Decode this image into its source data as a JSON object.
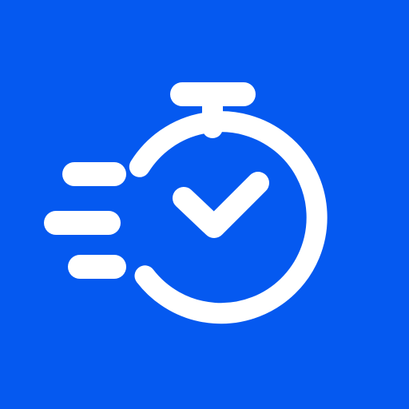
{
  "icon": {
    "name": "stopwatch-check-icon",
    "background_color": "#0559F0",
    "foreground_color": "#FFFFFF"
  }
}
